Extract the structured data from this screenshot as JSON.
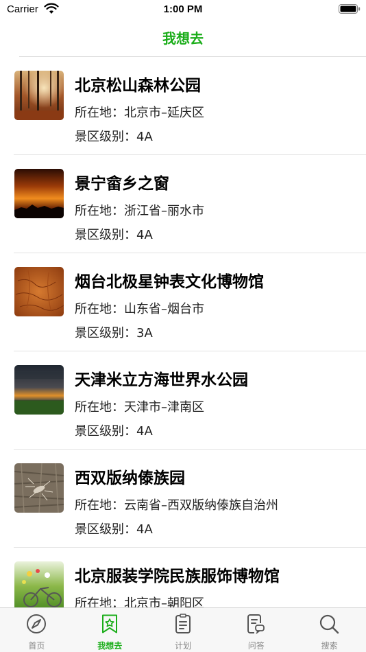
{
  "status_bar": {
    "carrier": "Carrier",
    "time": "1:00 PM"
  },
  "nav": {
    "title": "我想去"
  },
  "colors": {
    "accent": "#1aad19",
    "inactive": "#888888"
  },
  "items": [
    {
      "title": "北京松山森林公园",
      "location": "所在地：北京市–延庆区",
      "level": "景区级别：4A",
      "thumb": "autumn-forest"
    },
    {
      "title": "景宁畲乡之窗",
      "location": "所在地：浙江省–丽水市",
      "level": "景区级别：4A",
      "thumb": "sunset-sky"
    },
    {
      "title": "烟台北极星钟表文化博物馆",
      "location": "所在地：山东省–烟台市",
      "level": "景区级别：3A",
      "thumb": "leather-texture"
    },
    {
      "title": "天津米立方海世界水公园",
      "location": "所在地：天津市–津南区",
      "level": "景区级别：4A",
      "thumb": "storm-horizon"
    },
    {
      "title": "西双版纳傣族园",
      "location": "所在地：云南省–西双版纳傣族自治州",
      "level": "景区级别：4A",
      "thumb": "insect-on-bark"
    },
    {
      "title": "北京服装学院民族服饰博物馆",
      "location": "所在地：北京市–朝阳区",
      "level": "",
      "thumb": "flower-bicycle"
    }
  ],
  "tabs": [
    {
      "label": "首页",
      "icon": "compass-icon",
      "active": false
    },
    {
      "label": "我想去",
      "icon": "bookmark-star-icon",
      "active": true
    },
    {
      "label": "计划",
      "icon": "clipboard-icon",
      "active": false
    },
    {
      "label": "问答",
      "icon": "chat-document-icon",
      "active": false
    },
    {
      "label": "搜索",
      "icon": "search-icon",
      "active": false
    }
  ]
}
